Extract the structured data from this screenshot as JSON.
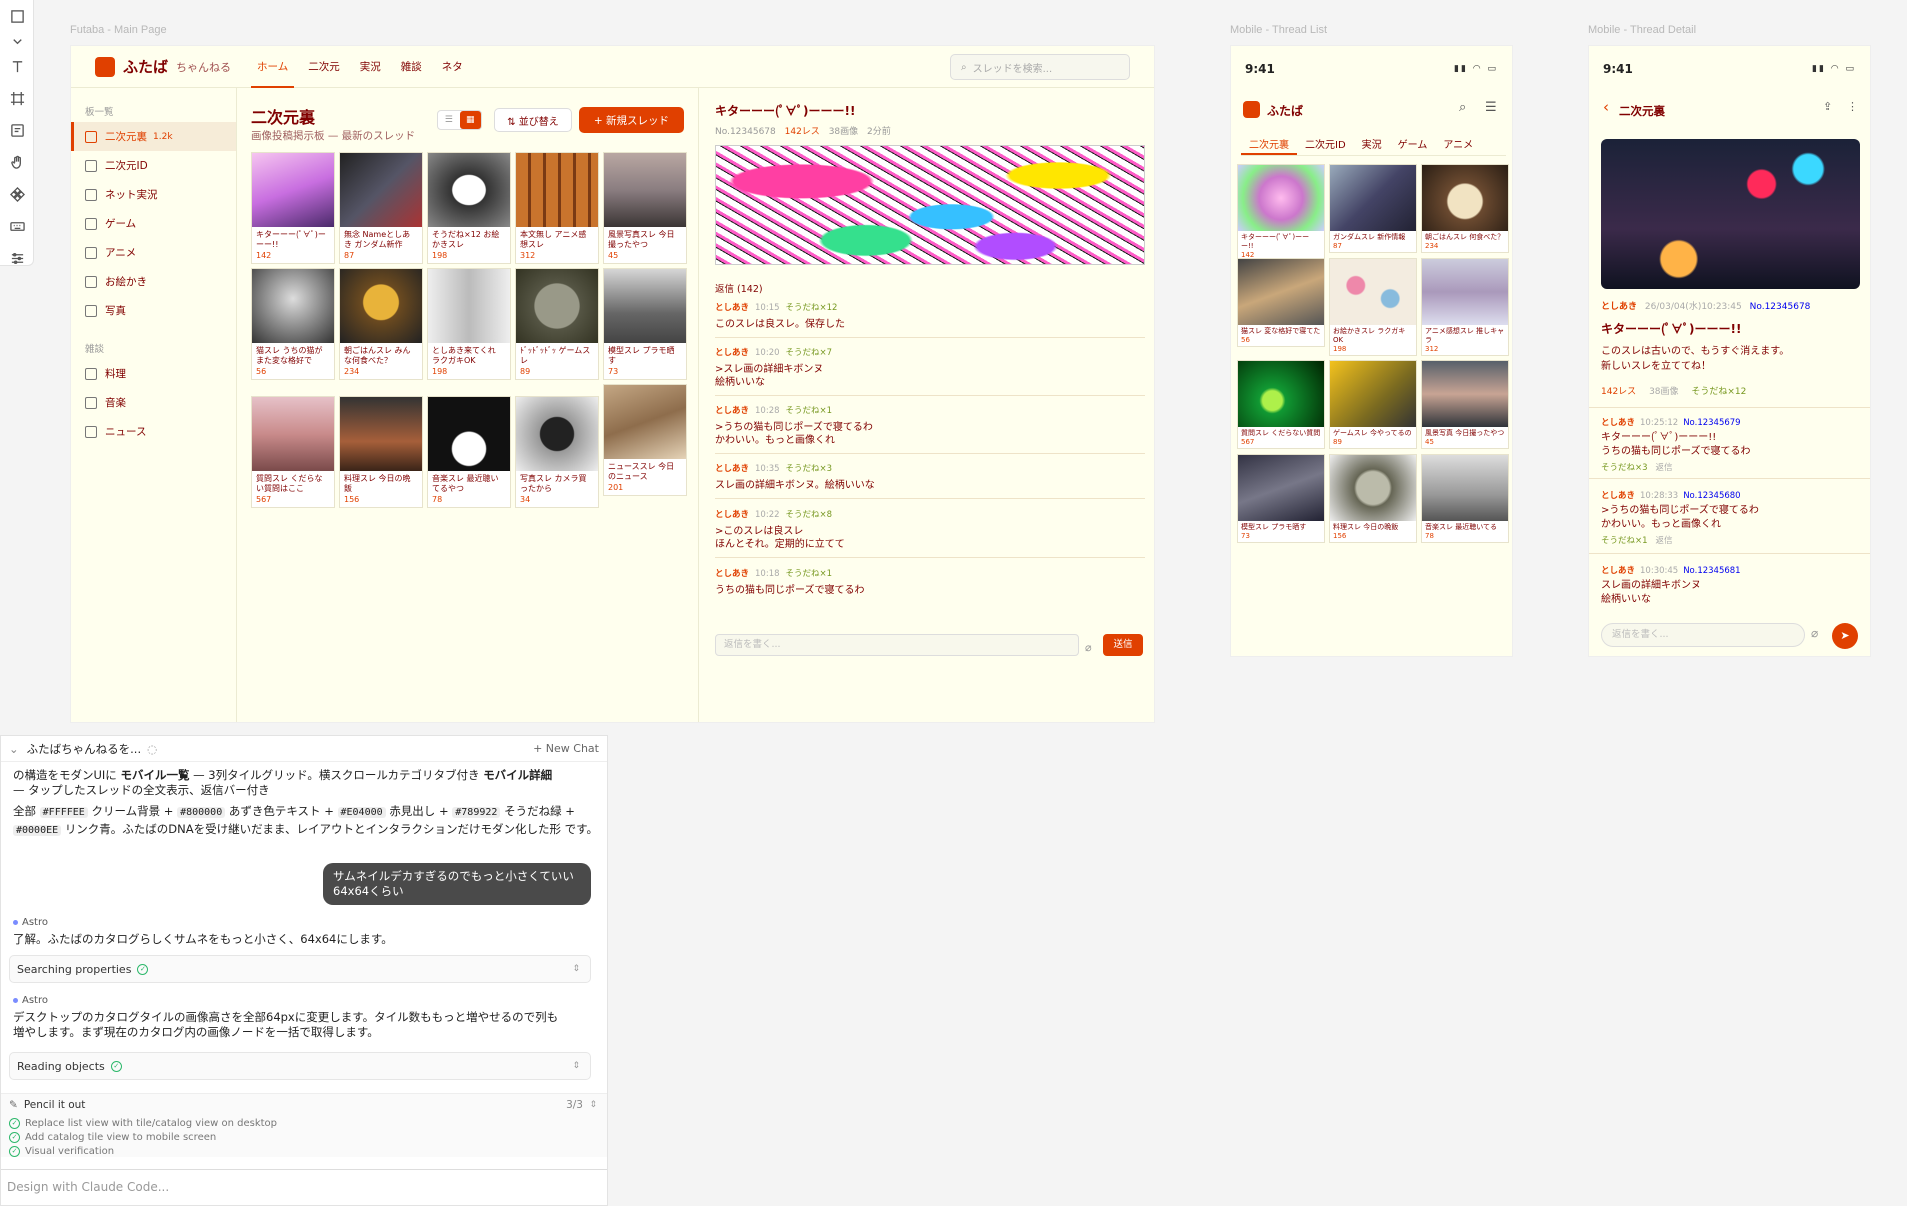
{
  "canvas": {
    "frame_main": "Futaba - Main Page",
    "frame_mobile_list": "Mobile - Thread List",
    "frame_mobile_detail": "Mobile - Thread Detail"
  },
  "colors": {
    "bg": "#FFFFEE",
    "text": "#800000",
    "accent": "#E04000",
    "sodane": "#789922",
    "link": "#0000EE"
  },
  "toolbar": {
    "tools": [
      "square-icon",
      "chevron-down-icon",
      "text-icon",
      "frame-icon",
      "note-icon",
      "hand-icon",
      "component-icon",
      "keyboard-icon",
      "sliders-icon"
    ]
  },
  "main": {
    "logo": "ふたば",
    "logo_sub": "ちゃんねる",
    "nav": [
      "ホーム",
      "二次元",
      "実況",
      "雑談",
      "ネタ"
    ],
    "search_placeholder": "スレッドを検索...",
    "sidebar": {
      "section1": "板一覧",
      "items1": [
        {
          "label": "二次元裏",
          "count": "1.2k",
          "icon": "image-icon"
        },
        {
          "label": "二次元ID",
          "icon": "chat-icon"
        },
        {
          "label": "ネット実況",
          "icon": "monitor-icon"
        },
        {
          "label": "ゲーム",
          "icon": "gamepad-icon"
        },
        {
          "label": "アニメ",
          "icon": "film-icon"
        },
        {
          "label": "お絵かき",
          "icon": "palette-icon"
        },
        {
          "label": "写真",
          "icon": "camera-icon"
        }
      ],
      "section2": "雑談",
      "items2": [
        {
          "label": "料理",
          "icon": "cup-icon"
        },
        {
          "label": "音楽",
          "icon": "music-icon"
        },
        {
          "label": "ニュース",
          "icon": "newspaper-icon"
        }
      ]
    },
    "board_title": "二次元裏",
    "board_sub": "画像投稿掲示板 — 最新のスレッド",
    "view_list": "☰",
    "view_grid": "▦",
    "sort_label": "⇅ 並び替え",
    "new_thread": "+ 新規スレッド",
    "tiles": [
      {
        "title": "キターーー(ﾟ∀ﾟ)ーーー!!",
        "count": "142"
      },
      {
        "title": "無念 Nameとしあき ガンダム新作",
        "count": "87"
      },
      {
        "title": "そうだね×12 お絵かきスレ",
        "count": "198"
      },
      {
        "title": "本文無し アニメ感想スレ",
        "count": "312"
      },
      {
        "title": "風景写真スレ 今日撮ったやつ",
        "count": "45"
      },
      {
        "title": "猫スレ うちの猫がまた変な格好で",
        "count": "56"
      },
      {
        "title": "朝ごはんスレ みんな何食べた？",
        "count": "234"
      },
      {
        "title": "としあき来てくれ ラクガキOK",
        "count": "198"
      },
      {
        "title": "ﾄﾞｯﾄﾞｯﾄﾞｯ ゲームスレ",
        "count": "89"
      },
      {
        "title": "模型スレ プラモ晒す",
        "count": "73"
      },
      {
        "title": "質問スレ くだらない質問はここ",
        "count": "567"
      },
      {
        "title": "料理スレ 今日の晩飯",
        "count": "156"
      },
      {
        "title": "音楽スレ 最近聴いてるやつ",
        "count": "78"
      },
      {
        "title": "写真スレ カメラ買ったから",
        "count": "34"
      },
      {
        "title": "ニューススレ 今日のニュース",
        "count": "201"
      }
    ],
    "thread": {
      "title": "キターーー(ﾟ∀ﾟ)ーーー!!",
      "no": "No.12345678",
      "res": "142レス",
      "images": "38画像",
      "ago": "2分前",
      "replies_header": "返信 (142)",
      "replies": [
        {
          "name": "としあき",
          "time": "10:15",
          "sodane": "そうだね×12",
          "body": "このスレは良スレ。保存した"
        },
        {
          "name": "としあき",
          "time": "10:20",
          "sodane": "そうだね×7",
          "body": ">スレ画の詳細キボンヌ\n絵柄いいな"
        },
        {
          "name": "としあき",
          "time": "10:28",
          "sodane": "そうだね×1",
          "body": ">うちの猫も同じポーズで寝てるわ\nかわいい。もっと画像くれ"
        },
        {
          "name": "としあき",
          "time": "10:35",
          "sodane": "そうだね×3",
          "body": "スレ画の詳細キボンヌ。絵柄いいな"
        },
        {
          "name": "としあき",
          "time": "10:22",
          "sodane": "そうだね×8",
          "body": ">このスレは良スレ\nほんとそれ。定期的に立てて"
        },
        {
          "name": "としあき",
          "time": "10:18",
          "sodane": "そうだね×1",
          "body": "うちの猫も同じポーズで寝てるわ"
        }
      ],
      "reply_placeholder": "返信を書く...",
      "send": "送信"
    }
  },
  "mobile_list": {
    "time": "9:41",
    "status": "▮▮ ◠ ▭",
    "logo": "ふたば",
    "tabs": [
      "二次元裏",
      "二次元ID",
      "実況",
      "ゲーム",
      "アニメ"
    ],
    "tiles": [
      {
        "title": "キターーー(ﾟ∀ﾟ)ーーー!!",
        "count": "142"
      },
      {
        "title": "ガンダムスレ 新作情報",
        "count": "87"
      },
      {
        "title": "朝ごはんスレ 何食べた？",
        "count": "234"
      },
      {
        "title": "猫スレ 変な格好で寝てた",
        "count": "56"
      },
      {
        "title": "お絵かきスレ ラクガキOK",
        "count": "198"
      },
      {
        "title": "アニメ感想スレ 推しキャラ",
        "count": "312"
      },
      {
        "title": "質問スレ くだらない質問",
        "count": "567"
      },
      {
        "title": "ゲームスレ 今やってるの",
        "count": "89"
      },
      {
        "title": "風景写真 今日撮ったやつ",
        "count": "45"
      },
      {
        "title": "模型スレ プラモ晒す",
        "count": "73"
      },
      {
        "title": "料理スレ 今日の晩飯",
        "count": "156"
      },
      {
        "title": "音楽スレ 最近聴いてる",
        "count": "78"
      }
    ]
  },
  "mobile_detail": {
    "time": "9:41",
    "status": "▮▮ ◠ ▭",
    "back": "‹",
    "title": "二次元裏",
    "op_name": "としあき",
    "op_date": "26/03/04(水)10:23:45",
    "op_no": "No.12345678",
    "op_title": "キターーー(ﾟ∀ﾟ)ーーー!!",
    "op_body": "このスレは古いので、もうすぐ消えます。\n新しいスレを立ててね！",
    "op_res": "142レス",
    "op_images": "38画像",
    "op_sodane": "そうだね×12",
    "replies": [
      {
        "name": "としあき",
        "time": "10:25:12",
        "no": "No.12345679",
        "body": "キターーー(ﾟ∀ﾟ)ーーー!!\nうちの猫も同じポーズで寝てるわ",
        "sodane": "そうだね×3",
        "action": "返信"
      },
      {
        "name": "としあき",
        "time": "10:28:33",
        "no": "No.12345680",
        "body": ">うちの猫も同じポーズで寝てるわ\nかわいい。もっと画像くれ",
        "sodane": "そうだね×1",
        "action": "返信"
      },
      {
        "name": "としあき",
        "time": "10:30:45",
        "no": "No.12345681",
        "body": "スレ画の詳細キボンヌ\n絵柄いいな",
        "sodane": "",
        "action": ""
      }
    ],
    "reply_placeholder": "返信を書く..."
  },
  "chat": {
    "title": "ふたばちゃんねるを...",
    "new_chat": "+ New Chat",
    "msg1_line1": "の構造をモダンUIに",
    "msg1_b1": "モバイル一覧",
    "msg1_line1b": "— 3列タイルグリッド。横スクロールカテゴリタブ付き",
    "msg1_b2": "モバイル詳細",
    "msg1_line2": "— タップしたスレッドの全文表示、返信バー付き",
    "msg1_line3a": "全部",
    "c1": "#FFFFEE",
    "msg1_t1": "クリーム背景 +",
    "c2": "#800000",
    "msg1_t2": "あずき色テキスト +",
    "c3": "#E04000",
    "msg1_t3": "赤見出し +",
    "c4": "#789922",
    "msg1_t4": "そうだね緑 +",
    "c5": "#0000EE",
    "msg1_t5": "リンク青。ふたばのDNAを受け継いだまま、レイアウトとインタラクションだけモダン化した形",
    "msg1_t6": "です。",
    "user_msg": "サムネイルデカすぎるのでもっと小さくていい\n64x64くらい",
    "astro1_name": "Astro",
    "astro1_body": "了解。ふたばのカタログらしくサムネをもっと小さく、64x64にします。",
    "tool1": "Searching properties",
    "astro2_name": "Astro",
    "astro2_body": "デスクトップのカタログタイルの画像高さを全部64pxに変更します。タイル数ももっと増やせるので列も\n増やします。まず現在のカタログ内の画像ノードを一括で取得します。",
    "tool2": "Reading objects",
    "plan_title": "Pencil it out",
    "plan_count": "3/3",
    "todos": [
      "Replace list view with tile/catalog view on desktop",
      "Add catalog tile view to mobile screen",
      "Visual verification"
    ],
    "input_placeholder": "Design with Claude Code..."
  }
}
